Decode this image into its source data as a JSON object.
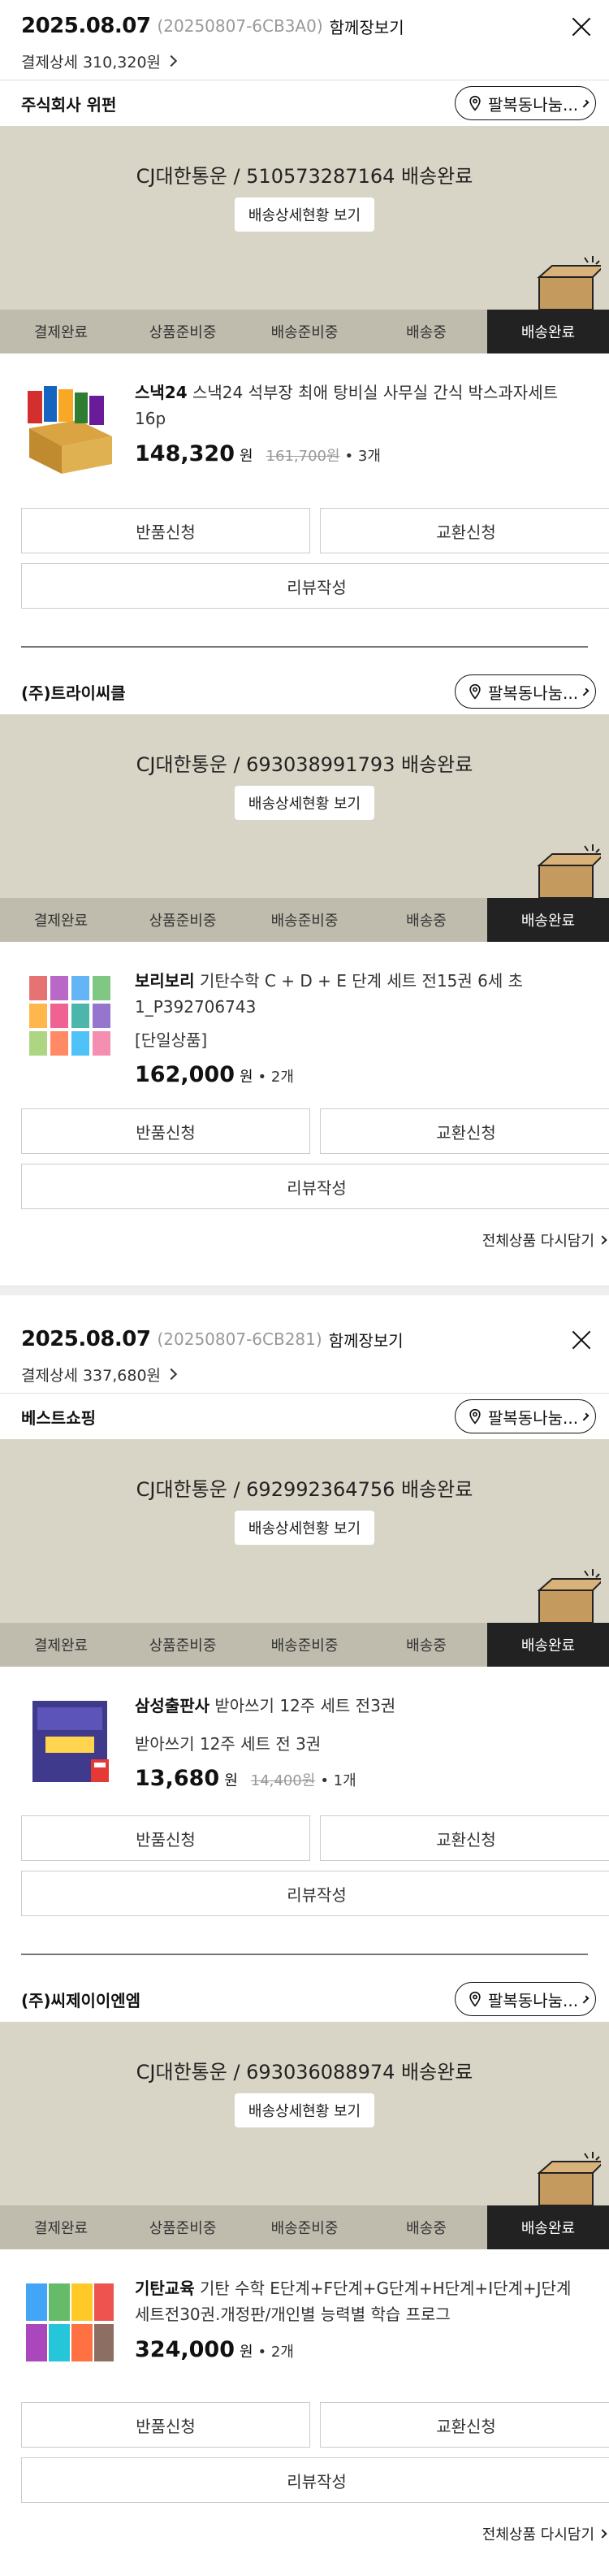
{
  "orders": [
    {
      "date": "2025.08.07",
      "order_no": "(20250807-6CB3A0)",
      "join_label": "함께장보기",
      "pay_detail": "결제상세 310,320원",
      "shipments": [
        {
          "seller": "주식회사 위펀",
          "pin_label": "팔복동나눔...",
          "tracking": "CJ대한통운 / 510573287164 배송완료",
          "detail_btn": "배송상세현황 보기",
          "steps": [
            "결제완료",
            "상품준비중",
            "배송준비중",
            "배송중",
            "배송완료"
          ],
          "brand": "스낵24",
          "name": "스낵24 석부장 최애 탕비실 사무실 간식 박스과자세트 16p",
          "option": "",
          "price": "148,320",
          "won": "원",
          "old_price": "161,700원",
          "qty": "• 3개",
          "return_btn": "반품신청",
          "exchange_btn": "교환신청",
          "review_btn": "리뷰작성"
        },
        {
          "seller": "(주)트라이씨클",
          "pin_label": "팔복동나눔...",
          "tracking": "CJ대한통운 / 693038991793 배송완료",
          "detail_btn": "배송상세현황 보기",
          "steps": [
            "결제완료",
            "상품준비중",
            "배송준비중",
            "배송중",
            "배송완료"
          ],
          "brand": "보리보리",
          "name": "기탄수학 C + D + E 단계 세트 전15권 6세 초1_P392706743",
          "option": "[단일상품]",
          "price": "162,000",
          "won": "원",
          "old_price": "",
          "qty": "• 2개",
          "return_btn": "반품신청",
          "exchange_btn": "교환신청",
          "review_btn": "리뷰작성"
        }
      ],
      "all_reorder": "전체상품 다시담기"
    },
    {
      "date": "2025.08.07",
      "order_no": "(20250807-6CB281)",
      "join_label": "함께장보기",
      "pay_detail": "결제상세 337,680원",
      "shipments": [
        {
          "seller": "베스트쇼핑",
          "pin_label": "팔복동나눔...",
          "tracking": "CJ대한통운 / 692992364756 배송완료",
          "detail_btn": "배송상세현황 보기",
          "steps": [
            "결제완료",
            "상품준비중",
            "배송준비중",
            "배송중",
            "배송완료"
          ],
          "brand": "삼성출판사",
          "name": "받아쓰기 12주 세트 전3권",
          "option": "받아쓰기 12주 세트 전 3권",
          "price": "13,680",
          "won": "원",
          "old_price": "14,400원",
          "qty": "• 1개",
          "return_btn": "반품신청",
          "exchange_btn": "교환신청",
          "review_btn": "리뷰작성"
        },
        {
          "seller": "(주)씨제이이엔엠",
          "pin_label": "팔복동나눔...",
          "tracking": "CJ대한통운 / 693036088974 배송완료",
          "detail_btn": "배송상세현황 보기",
          "steps": [
            "결제완료",
            "상품준비중",
            "배송준비중",
            "배송중",
            "배송완료"
          ],
          "brand": "기탄교육",
          "name": "기탄 수학 E단계+F단계+G단계+H단계+I단계+J단계 세트전30권.개정판/개인별 능력별 학습 프로그",
          "option": "",
          "price": "324,000",
          "won": "원",
          "old_price": "",
          "qty": "• 2개",
          "return_btn": "반품신청",
          "exchange_btn": "교환신청",
          "review_btn": "리뷰작성"
        }
      ],
      "all_reorder": "전체상품 다시담기"
    }
  ],
  "colors": {
    "ship_bg": "#d9d5c6",
    "step_bar": "#bfbbad",
    "step_active": "#222222"
  }
}
